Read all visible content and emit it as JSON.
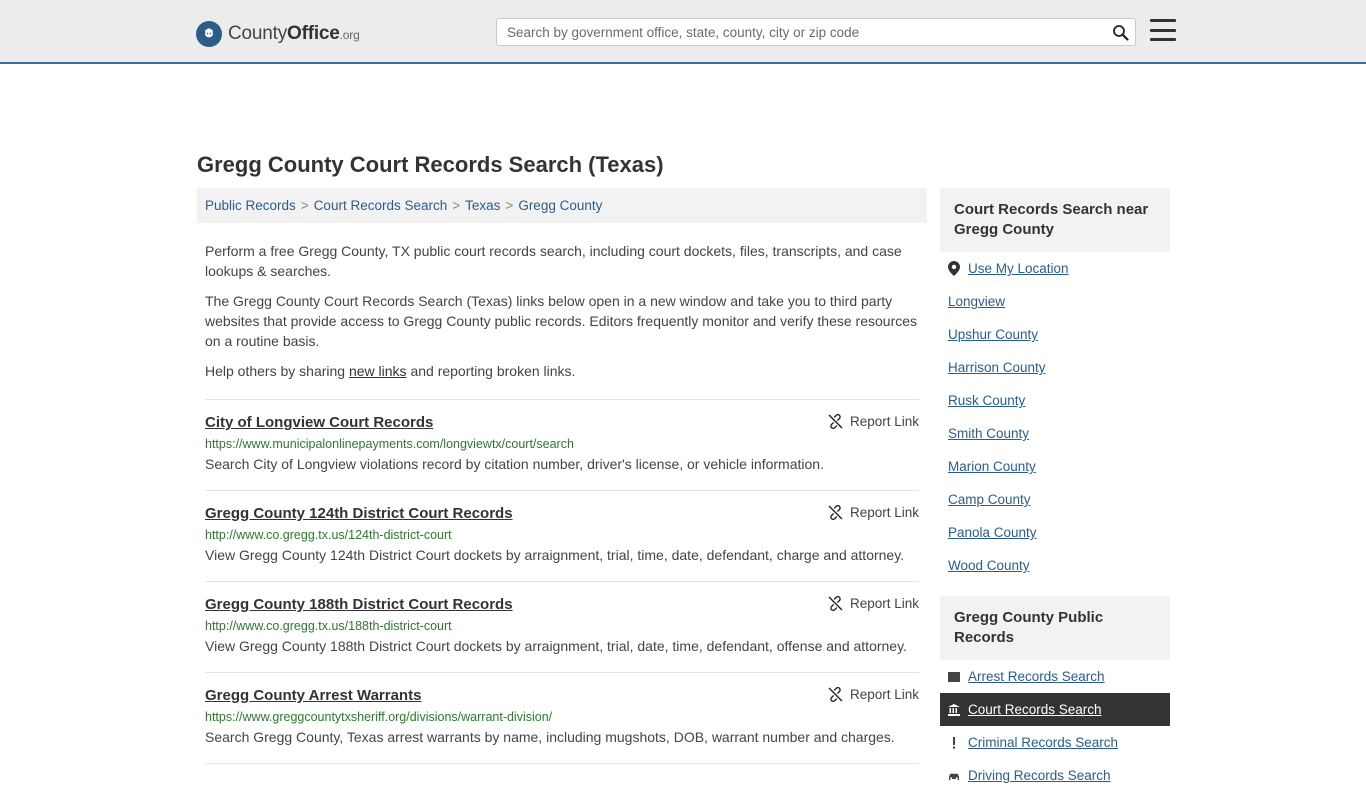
{
  "header": {
    "logo_primary": "County",
    "logo_secondary": "Office",
    "logo_suffix": ".org",
    "search_placeholder": "Search by government office, state, county, city or zip code",
    "search_value": "",
    "search_icon": "search-icon",
    "menu_icon": "hamburger-menu-icon"
  },
  "page": {
    "title": "Gregg County Court Records Search (Texas)"
  },
  "breadcrumb": {
    "items": [
      {
        "label": "Public Records"
      },
      {
        "label": "Court Records Search"
      },
      {
        "label": "Texas"
      },
      {
        "label": "Gregg County"
      }
    ],
    "separator": ">"
  },
  "intro": {
    "p1": "Perform a free Gregg County, TX public court records search, including court dockets, files, transcripts, and case lookups & searches.",
    "p2": "The Gregg County Court Records Search (Texas) links below open in a new window and take you to third party websites that provide access to Gregg County public records. Editors frequently monitor and verify these resources on a routine basis.",
    "p3_before": "Help others by sharing ",
    "p3_link": "new links",
    "p3_after": " and reporting broken links."
  },
  "report_label": "Report Link",
  "results": [
    {
      "title": "City of Longview Court Records",
      "url": "https://www.municipalonlinepayments.com/longviewtx/court/search",
      "description": "Search City of Longview violations record by citation number, driver's license, or vehicle information."
    },
    {
      "title": "Gregg County 124th District Court Records",
      "url": "http://www.co.gregg.tx.us/124th-district-court",
      "description": "View Gregg County 124th District Court dockets by arraignment, trial, time, date, defendant, charge and attorney."
    },
    {
      "title": "Gregg County 188th District Court Records",
      "url": "http://www.co.gregg.tx.us/188th-district-court",
      "description": "View Gregg County 188th District Court dockets by arraignment, trial, date, time, defendant, offense and attorney."
    },
    {
      "title": "Gregg County Arrest Warrants",
      "url": "https://www.greggcountytxsheriff.org/divisions/warrant-division/",
      "description": "Search Gregg County, Texas arrest warrants by name, including mugshots, DOB, warrant number and charges."
    }
  ],
  "sidebar": {
    "nearby": {
      "heading": "Court Records Search near Gregg County",
      "use_my_location": "Use My Location",
      "location_icon": "map-pin-icon",
      "items": [
        {
          "label": "Longview"
        },
        {
          "label": "Upshur County"
        },
        {
          "label": "Harrison County"
        },
        {
          "label": "Rusk County"
        },
        {
          "label": "Smith County"
        },
        {
          "label": "Marion County"
        },
        {
          "label": "Camp County"
        },
        {
          "label": "Panola County"
        },
        {
          "label": "Wood County"
        }
      ]
    },
    "public_records": {
      "heading": "Gregg County Public Records",
      "items": [
        {
          "label": "Arrest Records Search",
          "icon": "arrest-records-icon",
          "active": false
        },
        {
          "label": "Court Records Search",
          "icon": "courthouse-icon",
          "active": true
        },
        {
          "label": "Criminal Records Search",
          "icon": "exclamation-icon",
          "active": false
        },
        {
          "label": "Driving Records Search",
          "icon": "car-icon",
          "active": false
        }
      ]
    }
  }
}
